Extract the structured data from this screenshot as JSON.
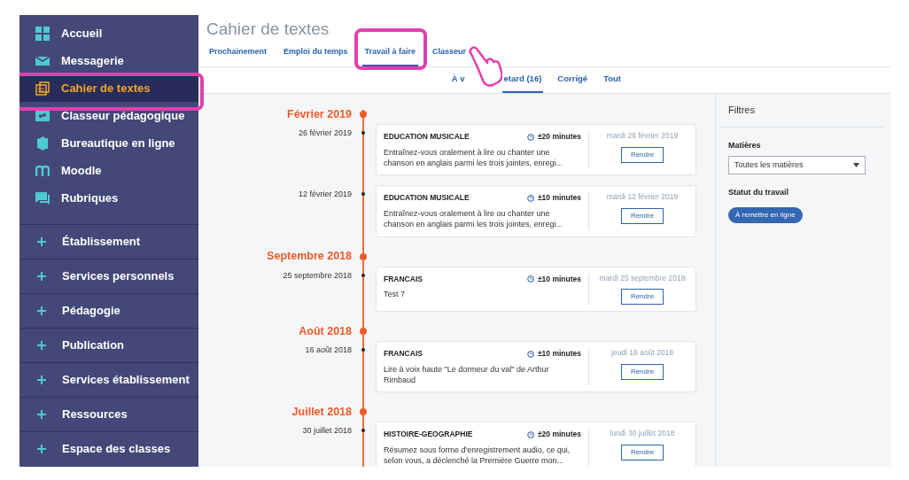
{
  "sidebar": {
    "items": [
      {
        "label": "Accueil",
        "selected": false
      },
      {
        "label": "Messagerie",
        "selected": false
      },
      {
        "label": "Cahier de textes",
        "selected": true
      },
      {
        "label": "Classeur pédagogique",
        "selected": false
      },
      {
        "label": "Bureautique en ligne",
        "selected": false
      },
      {
        "label": "Moodle",
        "selected": false
      },
      {
        "label": "Rubriques",
        "selected": false
      }
    ],
    "sections": [
      {
        "label": "Établissement",
        "expanded": false
      },
      {
        "label": "Services personnels",
        "expanded": false
      },
      {
        "label": "Pédagogie",
        "expanded": false
      },
      {
        "label": "Publication",
        "expanded": false
      },
      {
        "label": "Services établissement",
        "expanded": false
      },
      {
        "label": "Ressources",
        "expanded": false
      },
      {
        "label": "Espace des classes",
        "expanded": false
      }
    ]
  },
  "page_title": "Cahier de textes",
  "tabs": [
    {
      "label": "Prochainement",
      "selected": false
    },
    {
      "label": "Emploi du temps",
      "selected": false
    },
    {
      "label": "Travail à faire",
      "selected": true
    },
    {
      "label": "Classeur",
      "selected": false
    }
  ],
  "subtabs": [
    {
      "label": "À v",
      "selected": false
    },
    {
      "label": "etard (16)",
      "selected": true
    },
    {
      "label": "Corrigé",
      "selected": false
    },
    {
      "label": "Tout",
      "selected": false
    }
  ],
  "timeline": [
    {
      "month": "Février 2019",
      "entries": [
        {
          "date": "26 février 2019",
          "subject": "EDUCATION MUSICALE",
          "duration": "±20 minutes",
          "description": "Entraînez-vous oralement à lire ou chanter une chanson en anglais parmi les trois jointes, enregi...",
          "due": "mardi 26 février 2019",
          "button": "Rendre"
        },
        {
          "date": "12 février 2019",
          "subject": "EDUCATION MUSICALE",
          "duration": "±10 minutes",
          "description": "Entraînez-vous oralement à lire ou chanter une chanson en anglais parmi les trois jointes, enregi...",
          "due": "mardi 12 février 2019",
          "button": "Rendre"
        }
      ]
    },
    {
      "month": "Septembre 2018",
      "entries": [
        {
          "date": "25 septembre 2018",
          "subject": "FRANCAIS",
          "duration": "±10 minutes",
          "description": "Test 7",
          "due": "mardi 25 septembre 2018",
          "button": "Rendre"
        }
      ]
    },
    {
      "month": "Août 2018",
      "entries": [
        {
          "date": "16 août 2018",
          "subject": "FRANCAIS",
          "duration": "±10 minutes",
          "description": "Lire à voix haute \"Le dormeur du val\" de Arthur Rimbaud",
          "due": "jeudi 16 août 2018",
          "button": "Rendre"
        }
      ]
    },
    {
      "month": "Juillet 2018",
      "entries": [
        {
          "date": "30 juillet 2018",
          "subject": "HISTOIRE-GEOGRAPHIE",
          "duration": "±20 minutes",
          "description": "Résumez sous forme d'enregistrement audio, ce qui, selon vous, a déclenché la Première Guerre mon...",
          "due": "lundi 30 juillet 2018",
          "button": "Rendre"
        }
      ]
    }
  ],
  "filters": {
    "title": "Filtres",
    "subject_label": "Matières",
    "subject_value": "Toutes les matières",
    "status_label": "Statut du travail",
    "status_chips": [
      {
        "label": "À remettre en ligne",
        "selected": true
      }
    ]
  }
}
